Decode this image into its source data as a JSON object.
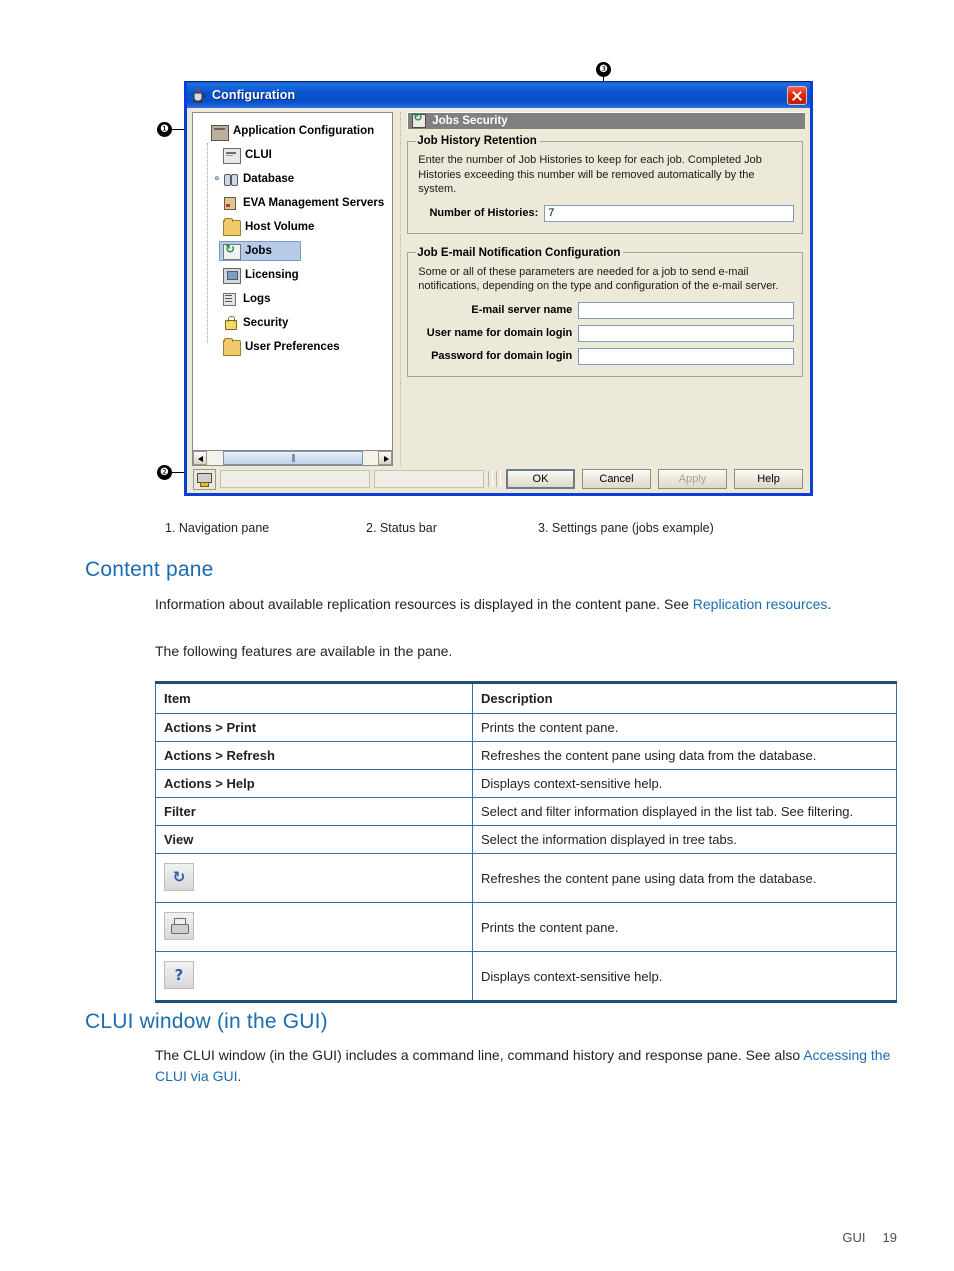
{
  "figure": {
    "callouts": [
      {
        "number": "❶",
        "id": "callout-1"
      },
      {
        "number": "❷",
        "id": "callout-2"
      },
      {
        "number": "❸",
        "id": "callout-3"
      }
    ],
    "dialog": {
      "title": "Configuration",
      "title_icon": "java-coffee-cup-icon",
      "close_label": "×",
      "nav_pane": {
        "root": {
          "label": "Application Configuration",
          "icon": "app-config-icon"
        },
        "items": [
          {
            "label": "CLUI",
            "icon": "clui-icon",
            "handle": "",
            "selected": false
          },
          {
            "label": "Database",
            "icon": "database-icon",
            "handle": "⚬",
            "selected": false
          },
          {
            "label": "EVA Management Servers",
            "icon": "server-icon",
            "handle": "",
            "selected": false
          },
          {
            "label": "Host Volume",
            "icon": "folder-icon",
            "handle": "",
            "selected": false
          },
          {
            "label": "Jobs",
            "icon": "jobs-icon",
            "handle": "",
            "selected": true
          },
          {
            "label": "Licensing",
            "icon": "licensing-icon",
            "handle": "",
            "selected": false
          },
          {
            "label": "Logs",
            "icon": "logs-icon",
            "handle": "",
            "selected": false
          },
          {
            "label": "Security",
            "icon": "security-lock-icon",
            "handle": "",
            "selected": false
          },
          {
            "label": "User Preferences",
            "icon": "folder-icon",
            "handle": "",
            "selected": false
          }
        ]
      },
      "settings_pane": {
        "header": "Jobs Security",
        "header_icon": "jobs-icon",
        "groups": [
          {
            "legend": "Job History Retention",
            "description": "Enter the number of Job Histories to keep for each job.  Completed Job Histories exceeding this number will be removed automatically by the system.",
            "fields": [
              {
                "label": "Number of Histories:",
                "value": "7",
                "placeholder": ""
              }
            ]
          },
          {
            "legend": "Job E-mail Notification Configuration",
            "description": "Some or all of these parameters are needed for a job to send e-mail notifications, depending on the type and configuration of the e-mail server.",
            "fields": [
              {
                "label": "E-mail server name",
                "value": "",
                "placeholder": ""
              },
              {
                "label": "User name for domain login",
                "value": "",
                "placeholder": ""
              },
              {
                "label": "Password for domain login",
                "value": "",
                "placeholder": ""
              }
            ]
          }
        ]
      },
      "status_bar": {
        "icon": "status-connection-icon"
      },
      "buttons": [
        {
          "label": "OK",
          "accel": "K",
          "state": "default",
          "name": "ok-button"
        },
        {
          "label": "Cancel",
          "accel": "C",
          "state": "normal",
          "name": "cancel-button"
        },
        {
          "label": "Apply",
          "accel": "A",
          "state": "disabled",
          "name": "apply-button"
        },
        {
          "label": "Help",
          "accel": "H",
          "state": "normal",
          "name": "help-button"
        }
      ]
    },
    "caption": [
      "1. Navigation pane",
      "2. Status bar",
      "3. Settings pane (jobs example)"
    ]
  },
  "content_section": {
    "heading": "Content pane",
    "para1_before": "Information about available replication resources is displayed in the content pane. See ",
    "para1_link": "Replication resources",
    "para1_after": ".",
    "para2": "The following features are available in the pane."
  },
  "table": {
    "headers": [
      "Item",
      "Description"
    ],
    "rows": [
      {
        "item": "Actions > Print",
        "icon": "",
        "desc": "Prints the content pane."
      },
      {
        "item": "Actions > Refresh",
        "icon": "",
        "desc": "Refreshes the content pane using data from the database."
      },
      {
        "item": "Actions > Help",
        "icon": "",
        "desc": "Displays context-sensitive help."
      },
      {
        "item": "Filter",
        "icon": "",
        "desc": "Select and filter information displayed in the list tab. See filtering."
      },
      {
        "item": "View",
        "icon": "",
        "desc": "Select the information displayed in tree tabs."
      },
      {
        "item": "",
        "icon": "refresh-icon",
        "desc": "Refreshes the content pane using data from the database."
      },
      {
        "item": "",
        "icon": "print-icon",
        "desc": "Prints the content pane."
      },
      {
        "item": "",
        "icon": "help-icon",
        "desc": "Displays context-sensitive help."
      }
    ]
  },
  "clui_section": {
    "heading": "CLUI window (in the GUI)",
    "para_before": "The CLUI window (in the GUI) includes a command line, command history and response pane. See also ",
    "para_link": "Accessing the CLUI via GUI",
    "para_after": "."
  },
  "footer": {
    "chapter": "GUI",
    "page": "19"
  },
  "colors": {
    "link": "#1c6bb0",
    "heading": "#1c6bb0",
    "table_border": "#3a6fa8",
    "table_rule": "#1f4e79",
    "titlebar": "#0a54cf",
    "selection": "#b5cbe8"
  }
}
